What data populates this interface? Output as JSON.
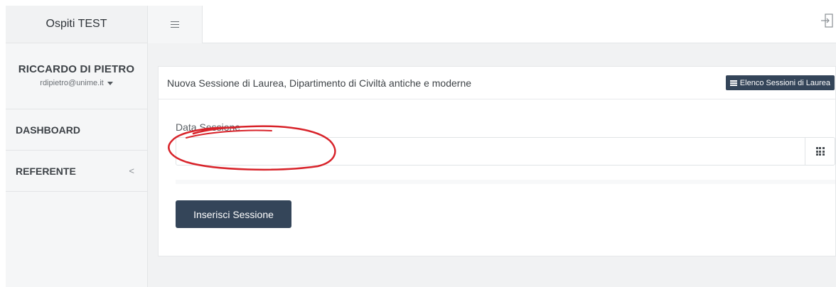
{
  "app": {
    "title": "Ospiti TEST"
  },
  "user": {
    "name": "RICCARDO DI PIETRO",
    "email": "rdipietro@unime.it"
  },
  "sidebar": {
    "items": [
      {
        "label": "DASHBOARD"
      },
      {
        "label": "REFERENTE",
        "chevron": "<"
      }
    ]
  },
  "topbar": {
    "menu_icon": "hamburger-icon",
    "logout_icon": "logout-icon"
  },
  "card": {
    "title": "Nuova Sessione di Laurea, Dipartimento di Civiltà antiche e moderne",
    "list_button_label": "Elenco Sessioni di Laurea",
    "list_button_icon": "list-icon"
  },
  "form": {
    "date_label": "Data Sessione",
    "date_value": "",
    "calendar_icon": "calendar-grid-icon",
    "submit_label": "Inserisci Sessione"
  },
  "colors": {
    "primary_button": "#344559",
    "sidebar_bg": "#f5f6f7",
    "content_bg": "#f1f2f3",
    "annotation_red": "#d8232a"
  }
}
